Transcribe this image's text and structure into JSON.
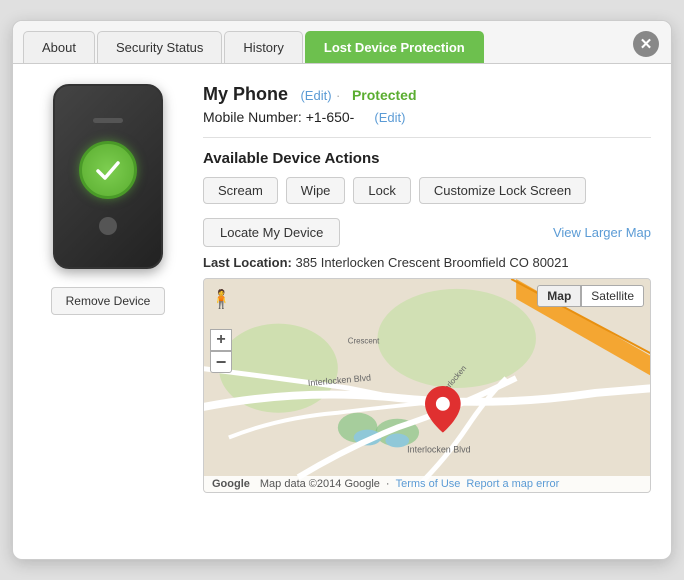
{
  "tabs": [
    {
      "id": "about",
      "label": "About",
      "active": false
    },
    {
      "id": "security-status",
      "label": "Security Status",
      "active": false
    },
    {
      "id": "history",
      "label": "History",
      "active": false
    },
    {
      "id": "lost-device-protection",
      "label": "Lost Device Protection",
      "active": true
    }
  ],
  "close_button": "✕",
  "device": {
    "name": "My Phone",
    "edit_label": "(Edit)",
    "status": "Protected",
    "mobile_label": "Mobile Number: +1-650-",
    "mobile_edit": "(Edit)"
  },
  "actions": {
    "title": "Available Device Actions",
    "buttons": [
      {
        "id": "scream",
        "label": "Scream"
      },
      {
        "id": "wipe",
        "label": "Wipe"
      },
      {
        "id": "lock",
        "label": "Lock"
      },
      {
        "id": "customize-lock-screen",
        "label": "Customize Lock Screen"
      }
    ]
  },
  "locate": {
    "button_label": "Locate My Device",
    "view_larger_map": "View Larger Map"
  },
  "last_location": {
    "label": "Last Location:",
    "address": "385 Interlocken Crescent Broomfield CO 80021"
  },
  "map": {
    "tab_map": "Map",
    "tab_satellite": "Satellite",
    "zoom_in": "+",
    "zoom_out": "−",
    "footer_data": "Map data ©2014 Google",
    "footer_terms": "Terms of Use",
    "footer_report": "Report a map error"
  },
  "remove_device": {
    "label": "Remove Device"
  }
}
